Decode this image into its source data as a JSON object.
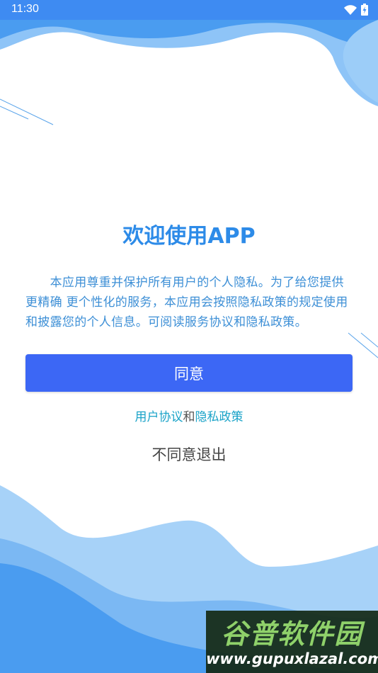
{
  "status_bar": {
    "time": "11:30",
    "wifi_icon": "wifi-icon",
    "battery_icon": "battery-charging-icon"
  },
  "dialog": {
    "title": "欢迎使用APP",
    "description": "　　本应用尊重并保护所有用户的个人隐私。为了给您提供更精确  更个性化的服务，本应用会按照隐私政策的规定使用和披露您的个人信息。可阅读服务协议和隐私政策。",
    "agree_label": "同意",
    "user_agreement_link": "用户协议",
    "and_text": "和",
    "privacy_policy_link": "隐私政策",
    "disagree_label": "不同意退出"
  },
  "watermark": {
    "name": "谷普软件园",
    "url": "www.gupuxlazal.com"
  },
  "colors": {
    "primary_button": "#3c67f5",
    "title": "#2d8be8",
    "link": "#1aa3c8",
    "wave_light": "#8ec4f7",
    "wave_dark": "#4a9cf0"
  }
}
